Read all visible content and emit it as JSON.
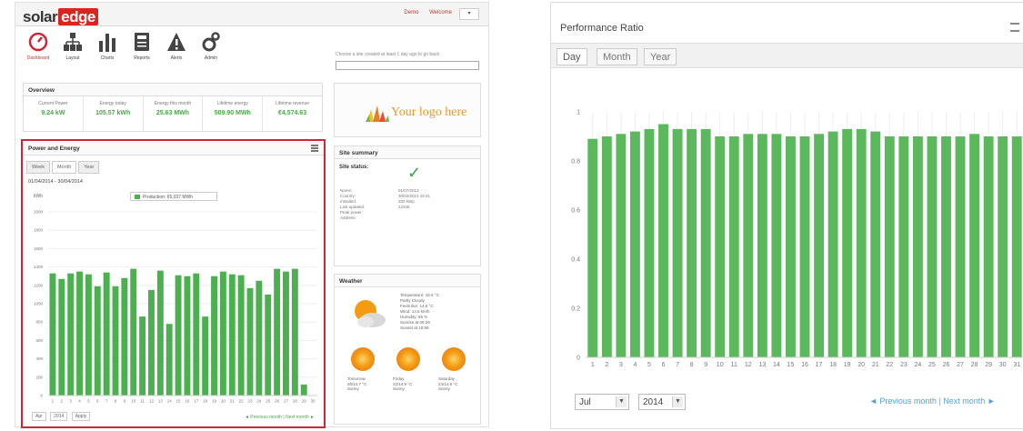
{
  "left_panel": {
    "logo": {
      "prefix": "solar",
      "suffix": "edge"
    },
    "top_links": [
      "Demo",
      "Welcome"
    ],
    "nav": [
      {
        "label": "Dashboard",
        "icon": "dashboard-icon",
        "active": true
      },
      {
        "label": "Layout",
        "icon": "layout-icon"
      },
      {
        "label": "Charts",
        "icon": "charts-icon"
      },
      {
        "label": "Reports",
        "icon": "reports-icon"
      },
      {
        "label": "Alerts",
        "icon": "alerts-icon"
      },
      {
        "label": "Admin",
        "icon": "admin-icon"
      }
    ],
    "tip_text": "Choose a site created at least 1 day ago to go back",
    "overview": {
      "title": "Overview",
      "cells": [
        {
          "label": "Current Power",
          "value": "9.24 kW"
        },
        {
          "label": "Energy today",
          "value": "105.57 kWh"
        },
        {
          "label": "Energy this month",
          "value": "25.63 MWh"
        },
        {
          "label": "Lifetime energy",
          "value": "509.90 MWh"
        },
        {
          "label": "Lifetime revenue",
          "value": "€4,574.63"
        }
      ]
    },
    "logo_placeholder": "Your logo here",
    "power_energy": {
      "title": "Power and Energy",
      "tabs": [
        "Week",
        "Month",
        "Year"
      ],
      "date_range": "01/04/2014 - 30/04/2014",
      "unit": "kWh",
      "legend": "Production: 65,037 MWh",
      "footer_selects": [
        "Apr",
        "2014"
      ],
      "footer_button": "Apply",
      "footer_links": "◄ Previous month  |  Next month ►"
    },
    "site_summary": {
      "title": "Site summary",
      "status_label": "Site status:",
      "rows": [
        "Name:",
        "Country:",
        "Installed:",
        "Last updated:",
        "Peak power:",
        "Address:"
      ],
      "values": [
        "",
        "",
        "01/07/2013",
        "30/04/2014 15:41",
        "200 kWp",
        "12345"
      ]
    },
    "weather": {
      "title": "Weather",
      "lines": [
        "Temperature: 15.6 °C",
        "Partly Cloudy",
        "Feels like: 14.6 °C",
        "Wind: 13.6 km/h",
        "Humidity: 65 %",
        "Sunrise at 06:29",
        "Sunset at 19:59"
      ],
      "days": [
        {
          "label": "Tomorrow",
          "temp": "20/14.7 °C",
          "cond": "Sunny"
        },
        {
          "label": "Friday",
          "temp": "22/14.9 °C",
          "cond": "Sunny"
        },
        {
          "label": "Saturday",
          "temp": "24/14.9 °C",
          "cond": "Sunny"
        }
      ]
    },
    "chart_data": {
      "type": "bar",
      "categories": [
        "1",
        "2",
        "3",
        "4",
        "5",
        "6",
        "7",
        "8",
        "9",
        "10",
        "11",
        "12",
        "13",
        "14",
        "15",
        "16",
        "17",
        "18",
        "19",
        "20",
        "21",
        "22",
        "23",
        "24",
        "25",
        "26",
        "27",
        "28",
        "29",
        "30"
      ],
      "values": [
        1330,
        1270,
        1330,
        1350,
        1320,
        1190,
        1340,
        1190,
        1280,
        1380,
        860,
        1150,
        1360,
        780,
        1310,
        1300,
        1330,
        860,
        1300,
        1350,
        1320,
        1310,
        1170,
        1250,
        1100,
        1380,
        1350,
        1380,
        120,
        0
      ],
      "ylim": [
        0,
        2000
      ],
      "yticks": [
        "0",
        "200",
        "400",
        "600",
        "800",
        "1000",
        "1200",
        "1400",
        "1600",
        "1800",
        "2000"
      ]
    }
  },
  "right_panel": {
    "title": "Performance Ratio",
    "tabs": [
      "Day",
      "Month",
      "Year"
    ],
    "month_select": "Jul",
    "year_select": "2014",
    "nav_links": "◄ Previous month  |  Next month ►",
    "chart_data": {
      "type": "bar",
      "categories": [
        "1",
        "2",
        "3",
        "4",
        "5",
        "6",
        "7",
        "8",
        "9",
        "10",
        "11",
        "12",
        "13",
        "14",
        "15",
        "16",
        "17",
        "18",
        "19",
        "20",
        "21",
        "22",
        "23",
        "24",
        "25",
        "26",
        "27",
        "28",
        "29",
        "30",
        "31"
      ],
      "values": [
        0.89,
        0.9,
        0.91,
        0.92,
        0.93,
        0.95,
        0.93,
        0.93,
        0.93,
        0.9,
        0.9,
        0.91,
        0.91,
        0.91,
        0.9,
        0.9,
        0.91,
        0.92,
        0.93,
        0.93,
        0.92,
        0.9,
        0.9,
        0.9,
        0.9,
        0.9,
        0.9,
        0.91,
        0.9,
        0.9,
        0.9
      ],
      "ylim": [
        0,
        1
      ],
      "yticks": [
        "0",
        "0.2",
        "0.4",
        "0.6",
        "0.8",
        "1"
      ],
      "bar_color": "#5cb85c"
    }
  },
  "colors": {
    "accent_red": "#c92838",
    "green": "#4caf50",
    "link_blue": "#5a9fd4"
  }
}
